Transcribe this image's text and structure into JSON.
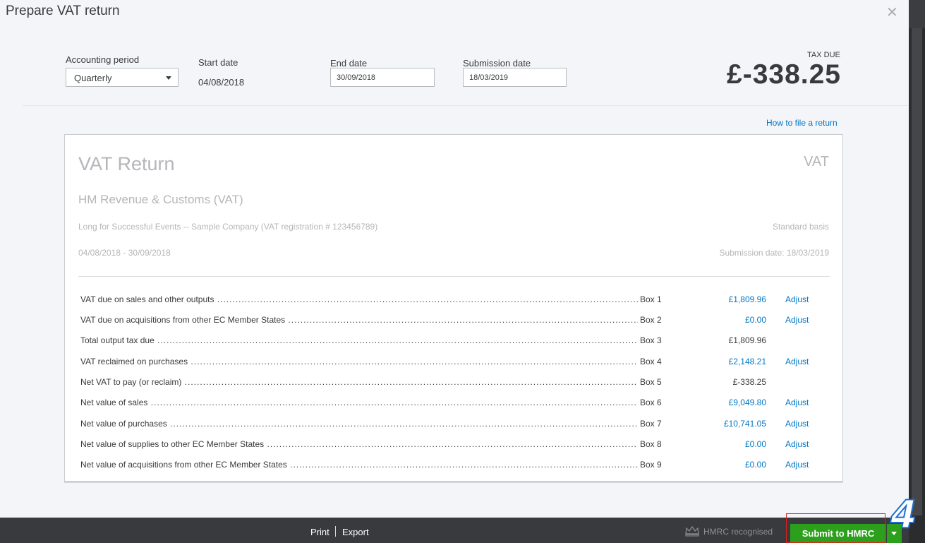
{
  "dialog": {
    "title": "Prepare VAT return",
    "close_icon": "close-icon"
  },
  "period": {
    "accounting_period_label": "Accounting period",
    "accounting_period_value": "Quarterly",
    "start_date_label": "Start date",
    "start_date_value": "04/08/2018",
    "end_date_label": "End date",
    "end_date_value": "30/09/2018",
    "submission_date_label": "Submission date",
    "submission_date_value": "18/03/2019"
  },
  "tax_due": {
    "label": "TAX DUE",
    "amount": "£-338.25"
  },
  "help_link": "How to file a return",
  "report": {
    "title": "VAT Return",
    "tag": "VAT",
    "subtitle": "HM Revenue & Customs (VAT)",
    "company": "Long for Successful Events -- Sample Company (VAT registration # 123456789)",
    "basis": "Standard basis",
    "date_range": "04/08/2018 - 30/09/2018",
    "submission_date": "Submission date: 18/03/2019",
    "adjust_label": "Adjust",
    "rows": [
      {
        "desc": "VAT due on sales and other outputs",
        "box": "Box 1",
        "amount": "£1,809.96",
        "adjustable": true
      },
      {
        "desc": "VAT due on acquisitions from other EC Member States",
        "box": "Box 2",
        "amount": "£0.00",
        "adjustable": true
      },
      {
        "desc": "Total output tax due",
        "box": "Box 3",
        "amount": "£1,809.96",
        "adjustable": false
      },
      {
        "desc": "VAT reclaimed on purchases",
        "box": "Box 4",
        "amount": "£2,148.21",
        "adjustable": true
      },
      {
        "desc": "Net VAT to pay (or reclaim)",
        "box": "Box 5",
        "amount": "£-338.25",
        "adjustable": false
      },
      {
        "desc": "Net value of sales",
        "box": "Box 6",
        "amount": "£9,049.80",
        "adjustable": true
      },
      {
        "desc": "Net value of purchases",
        "box": "Box 7",
        "amount": "£10,741.05",
        "adjustable": true
      },
      {
        "desc": "Net value of supplies to other EC Member States",
        "box": "Box 8",
        "amount": "£0.00",
        "adjustable": true
      },
      {
        "desc": "Net value of acquisitions from other EC Member States",
        "box": "Box 9",
        "amount": "£0.00",
        "adjustable": true
      }
    ]
  },
  "footer": {
    "print_label": "Print",
    "export_label": "Export",
    "hmrc_label": "HMRC recognised",
    "hmrc_icon": "crown-icon",
    "submit_label": "Submit to HMRC"
  },
  "annotation": {
    "step_number": "4"
  },
  "colors": {
    "link": "#0077c5",
    "primary_button": "#2ca01c",
    "footer": "#393a3d",
    "highlight_box": "#e0201c",
    "step_badge": "#1e6fd0"
  }
}
